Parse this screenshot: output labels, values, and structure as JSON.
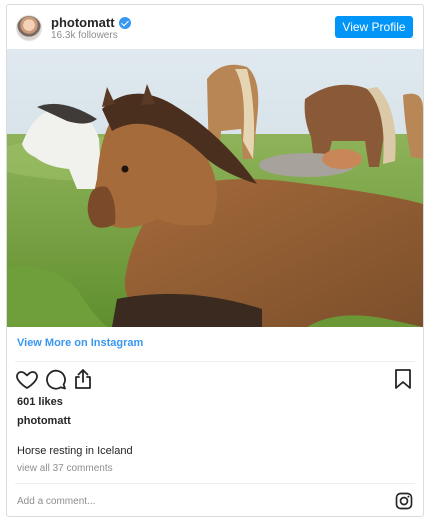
{
  "header": {
    "username": "photomatt",
    "followers": "16.3k followers",
    "view_profile_label": "View Profile",
    "verified_icon": "verified-badge-icon"
  },
  "post": {
    "image_subject": "horses",
    "view_more_label": "View More on Instagram",
    "likes": "601 likes",
    "username": "photomatt",
    "caption": "Horse resting in Iceland",
    "view_comments": "view all 37 comments",
    "add_comment_placeholder": "Add a comment..."
  },
  "icons": {
    "like": "heart-icon",
    "comment": "comment-icon",
    "share": "share-icon",
    "save": "bookmark-icon",
    "brand": "instagram-icon"
  },
  "colors": {
    "accent": "#0095f6",
    "link": "#3897f0",
    "muted": "#8e8e8e",
    "border": "#dbdbdb"
  }
}
